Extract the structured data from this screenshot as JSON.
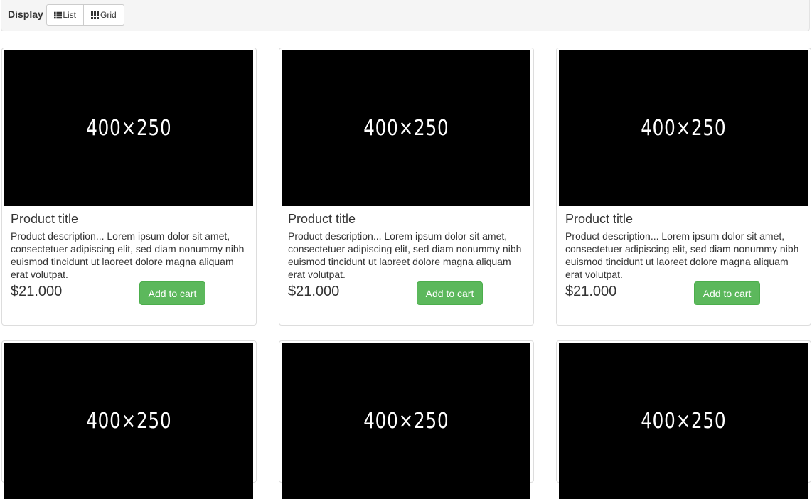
{
  "toolbar": {
    "label": "Display",
    "list_label": "List",
    "grid_label": "Grid",
    "list_icon": "list-icon",
    "grid_icon": "grid-icon"
  },
  "products": [
    {
      "image_text": "400×250",
      "title": "Product title",
      "description": "Product description... Lorem ipsum dolor sit amet, consectetuer adipiscing elit, sed diam nonummy nibh euismod tincidunt ut laoreet dolore magna aliquam erat volutpat.",
      "price": "$21.000",
      "button": "Add to cart"
    },
    {
      "image_text": "400×250",
      "title": "Product title",
      "description": "Product description... Lorem ipsum dolor sit amet, consectetuer adipiscing elit, sed diam nonummy nibh euismod tincidunt ut laoreet dolore magna aliquam erat volutpat.",
      "price": "$21.000",
      "button": "Add to cart"
    },
    {
      "image_text": "400×250",
      "title": "Product title",
      "description": "Product description... Lorem ipsum dolor sit amet, consectetuer adipiscing elit, sed diam nonummy nibh euismod tincidunt ut laoreet dolore magna aliquam erat volutpat.",
      "price": "$21.000",
      "button": "Add to cart"
    },
    {
      "image_text": "400×250"
    },
    {
      "image_text": "400×250"
    },
    {
      "image_text": "400×250"
    }
  ],
  "colors": {
    "toolbar_bg": "#f5f5f5",
    "add_button": "#5cb85c",
    "image_placeholder": "#000000"
  }
}
